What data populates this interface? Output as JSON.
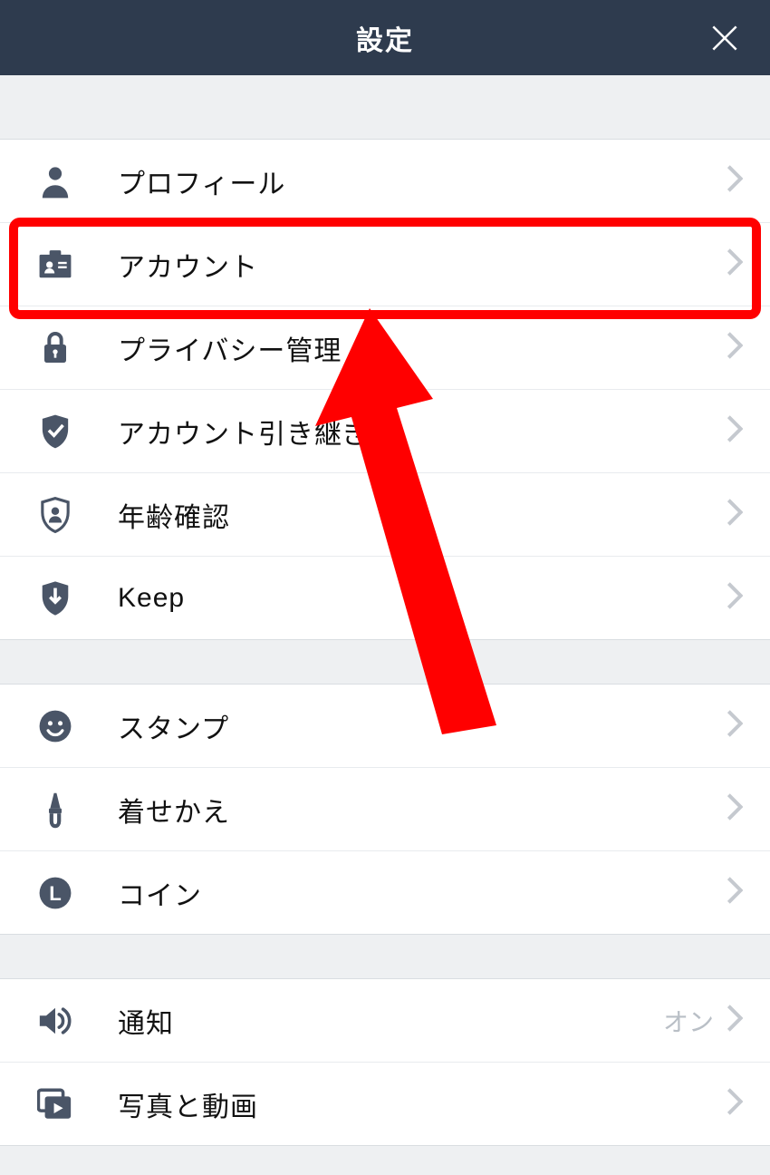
{
  "header": {
    "title": "設定"
  },
  "sections": [
    {
      "rows": [
        {
          "icon": "user",
          "label": "プロフィール",
          "value": ""
        },
        {
          "icon": "id-card",
          "label": "アカウント",
          "value": ""
        },
        {
          "icon": "lock",
          "label": "プライバシー管理",
          "value": ""
        },
        {
          "icon": "shield-check",
          "label": "アカウント引き継ぎ",
          "value": ""
        },
        {
          "icon": "shield-user",
          "label": "年齢確認",
          "value": ""
        },
        {
          "icon": "download",
          "label": "Keep",
          "value": ""
        }
      ]
    },
    {
      "rows": [
        {
          "icon": "smile",
          "label": "スタンプ",
          "value": ""
        },
        {
          "icon": "brush",
          "label": "着せかえ",
          "value": ""
        },
        {
          "icon": "coin-l",
          "label": "コイン",
          "value": ""
        }
      ]
    },
    {
      "rows": [
        {
          "icon": "speaker",
          "label": "通知",
          "value": "オン"
        },
        {
          "icon": "media",
          "label": "写真と動画",
          "value": ""
        }
      ]
    }
  ]
}
